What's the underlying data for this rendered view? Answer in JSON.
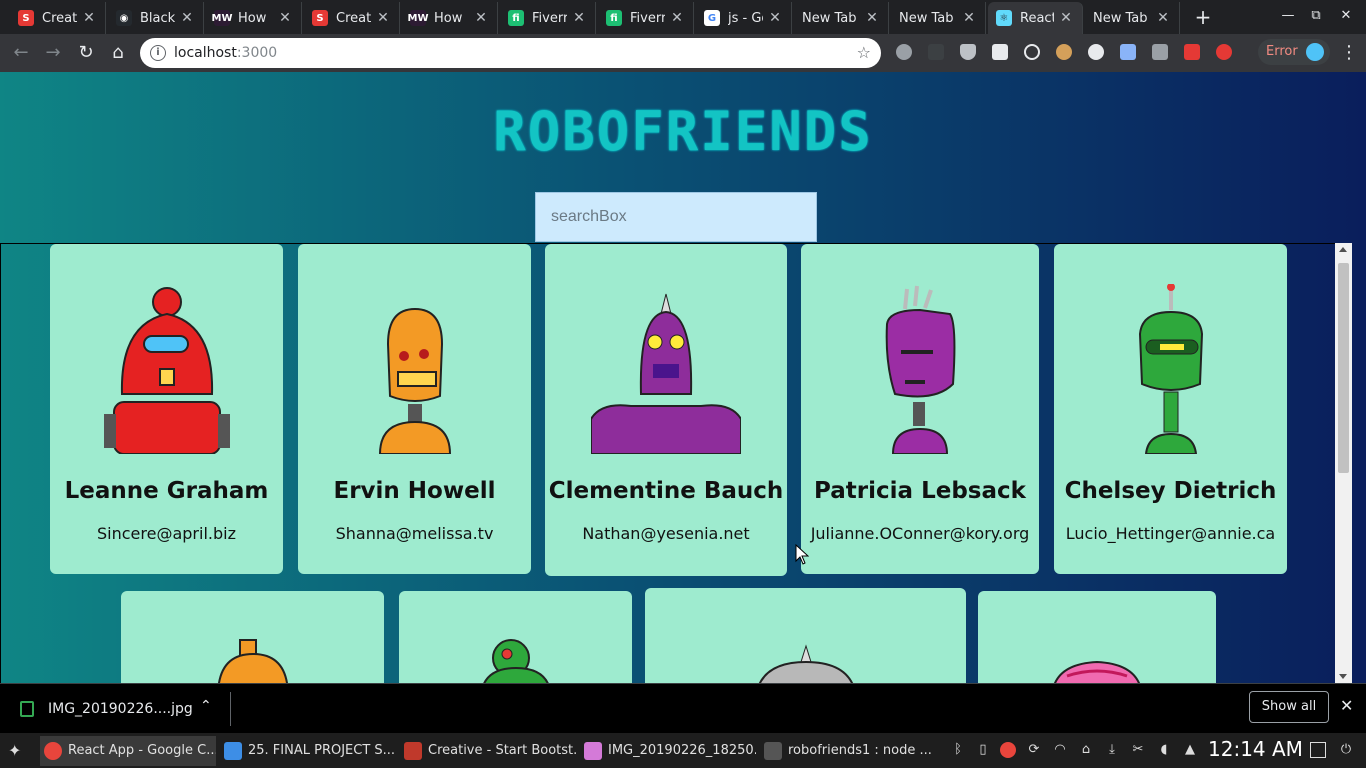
{
  "browser": {
    "tabs": [
      {
        "label": "Creat",
        "icon": "s-icon",
        "color": "#e53935",
        "glyph": "S"
      },
      {
        "label": "Blackr",
        "icon": "github-icon",
        "color": "#24292e",
        "glyph": "◉"
      },
      {
        "label": "How",
        "icon": "mw-icon",
        "color": "#2d1b33",
        "glyph": "MW"
      },
      {
        "label": "Creat",
        "icon": "s-icon",
        "color": "#e53935",
        "glyph": "S"
      },
      {
        "label": "How",
        "icon": "mw-icon",
        "color": "#2d1b33",
        "glyph": "MW"
      },
      {
        "label": "Fiverr",
        "icon": "fiverr-icon",
        "color": "#1dbf73",
        "glyph": "fi"
      },
      {
        "label": "Fiverr",
        "icon": "fiverr-icon",
        "color": "#1dbf73",
        "glyph": "fi"
      },
      {
        "label": "js - Go",
        "icon": "google-icon",
        "color": "#ffffff",
        "glyph": "G"
      },
      {
        "label": "New Tab",
        "icon": "",
        "color": "",
        "glyph": ""
      },
      {
        "label": "New Tab",
        "icon": "",
        "color": "",
        "glyph": ""
      },
      {
        "label": "React",
        "icon": "react-icon",
        "color": "#61dafb",
        "glyph": "⚛",
        "active": true
      },
      {
        "label": "New Tab",
        "icon": "",
        "color": "",
        "glyph": ""
      }
    ],
    "new_tab": "+",
    "window_controls": {
      "minimize": "—",
      "maximize": "⧉",
      "close": "✕"
    },
    "address": {
      "host": "localhost",
      "port": ":3000"
    },
    "error_label": "Error"
  },
  "page": {
    "title": "ROBOFRIENDS",
    "search_placeholder": "searchBox",
    "cards_row1": [
      {
        "name": "Leanne Graham",
        "email": "Sincere@april.biz",
        "color": "#e52222"
      },
      {
        "name": "Ervin Howell",
        "email": "Shanna@melissa.tv",
        "color": "#f39a25"
      },
      {
        "name": "Clementine Bauch",
        "email": "Nathan@yesenia.net",
        "color": "#8e2d9b"
      },
      {
        "name": "Patricia Lebsack",
        "email": "Julianne.OConner@kory.org",
        "color": "#9b2da4"
      },
      {
        "name": "Chelsey Dietrich",
        "email": "Lucio_Hettinger@annie.ca",
        "color": "#2ea83c"
      }
    ],
    "cards_row2": [
      {
        "color": "#f39a25"
      },
      {
        "color": "#2ea83c"
      },
      {
        "color": "#b8b8b8"
      },
      {
        "color": "#f06ab0"
      }
    ]
  },
  "downloads": {
    "file": "IMG_20190226....jpg",
    "show_all": "Show all"
  },
  "taskbar": {
    "tasks": [
      {
        "label": "React App - Google C...",
        "color": "#e8453c"
      },
      {
        "label": "25. FINAL PROJECT S...",
        "color": "#3d8ee6"
      },
      {
        "label": "Creative - Start Bootst...",
        "color": "#c0392b"
      },
      {
        "label": "IMG_20190226_18250...",
        "color": "#d47ad8"
      },
      {
        "label": "robofriends1 : node ...",
        "color": "#555555"
      }
    ],
    "clock": "12:14 AM"
  }
}
